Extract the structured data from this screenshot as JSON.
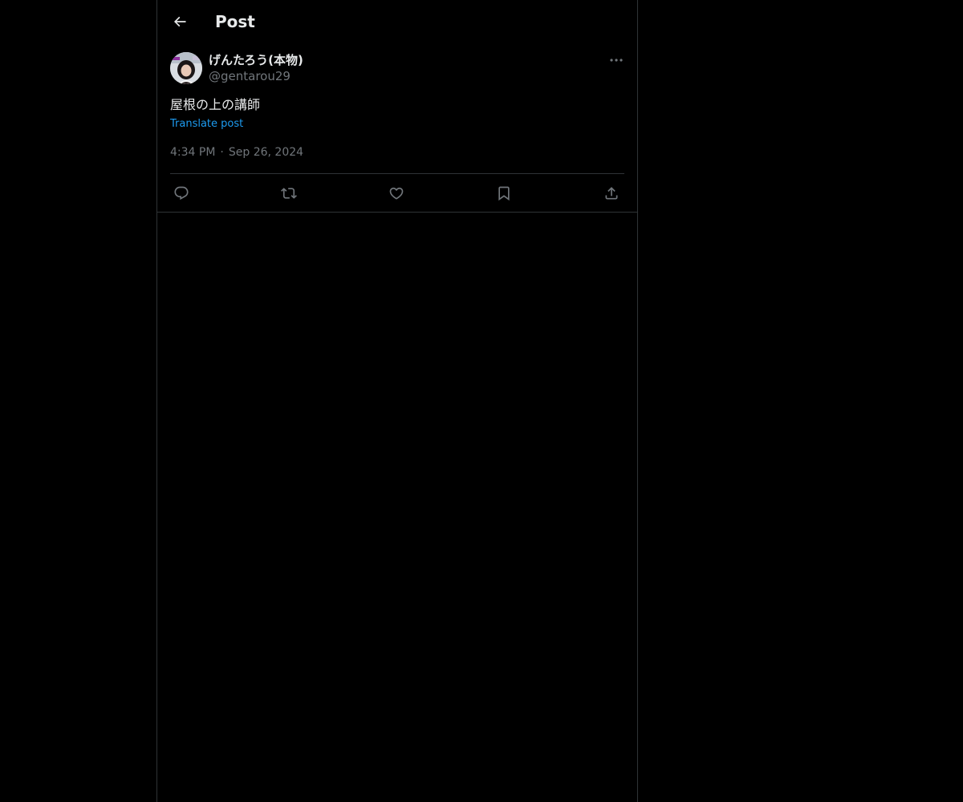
{
  "header": {
    "title": "Post",
    "back_icon": "arrow-left-icon"
  },
  "post": {
    "author": {
      "display_name": "げんたろう(本物)",
      "handle": "@gentarou29",
      "avatar_icon": "avatar-photo"
    },
    "text": "屋根の上の講師",
    "translate_label": "Translate post",
    "time": "4:34 PM",
    "separator": "·",
    "date": "Sep 26, 2024",
    "more_icon": "more-horizontal-icon",
    "actions": [
      {
        "icon": "reply-icon"
      },
      {
        "icon": "repost-icon"
      },
      {
        "icon": "like-icon"
      },
      {
        "icon": "bookmark-icon"
      },
      {
        "icon": "share-icon"
      }
    ]
  },
  "colors": {
    "background": "#000000",
    "text_primary": "#e7e9ea",
    "text_secondary": "#71767b",
    "link": "#1d9bf0",
    "border": "#2f3336"
  }
}
